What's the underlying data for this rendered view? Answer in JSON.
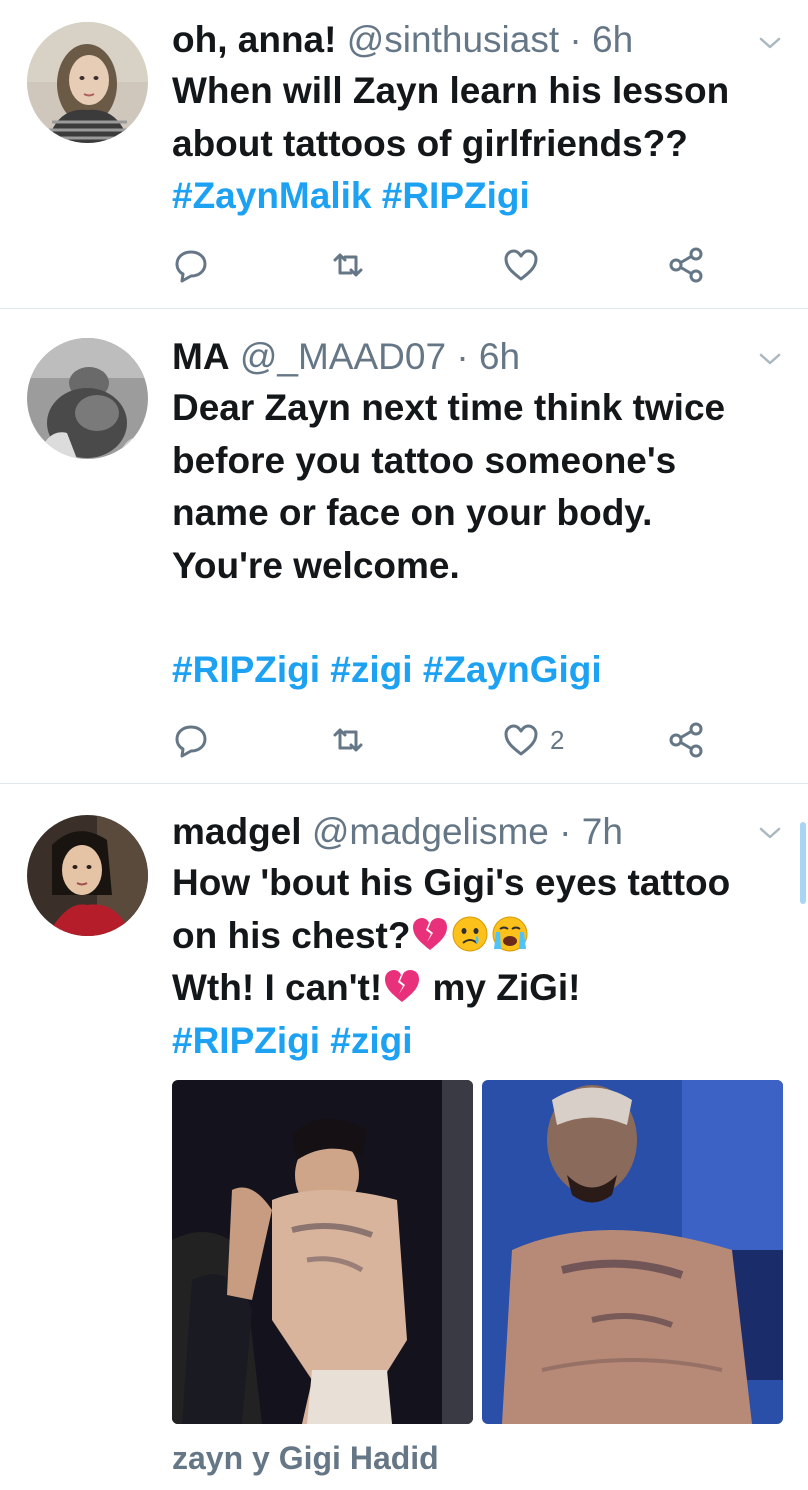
{
  "tweets": [
    {
      "name": "oh, anna!",
      "handle": "@sinthusiast",
      "time": "6h",
      "lines": [
        "When will Zayn learn his lesson",
        "about tattoos of girlfriends??"
      ],
      "hashtags": "#ZaynMalik #RIPZigi",
      "like_count": ""
    },
    {
      "name": "MA",
      "handle": "@_MAAD07",
      "time": "6h",
      "lines": [
        "Dear Zayn next time think twice",
        "before you tattoo someone's",
        "name or face on your body.",
        "You're welcome."
      ],
      "hashtags": "#RIPZigi #zigi #ZaynGigi",
      "like_count": "2"
    },
    {
      "name": "madgel",
      "handle": "@madgelisme",
      "time": "7h",
      "line1": "How 'bout his Gigi's eyes tattoo",
      "line2_text": "on his chest?",
      "line3_a": "Wth! I can't!",
      "line3_b": " my ZiGi!",
      "hashtags": "#RIPZigi #zigi",
      "caption": "zayn y Gigi Hadid",
      "like_count": ""
    }
  ],
  "separator": "·",
  "colors": {
    "link": "#1da1f2",
    "meta": "#657786",
    "divider": "#e1e8ed",
    "text": "#14171a"
  },
  "icons": [
    "reply-icon",
    "retweet-icon",
    "like-icon",
    "share-icon",
    "chevron-down-icon",
    "broken-heart-emoji",
    "crying-face-emoji",
    "loudly-crying-face-emoji"
  ]
}
